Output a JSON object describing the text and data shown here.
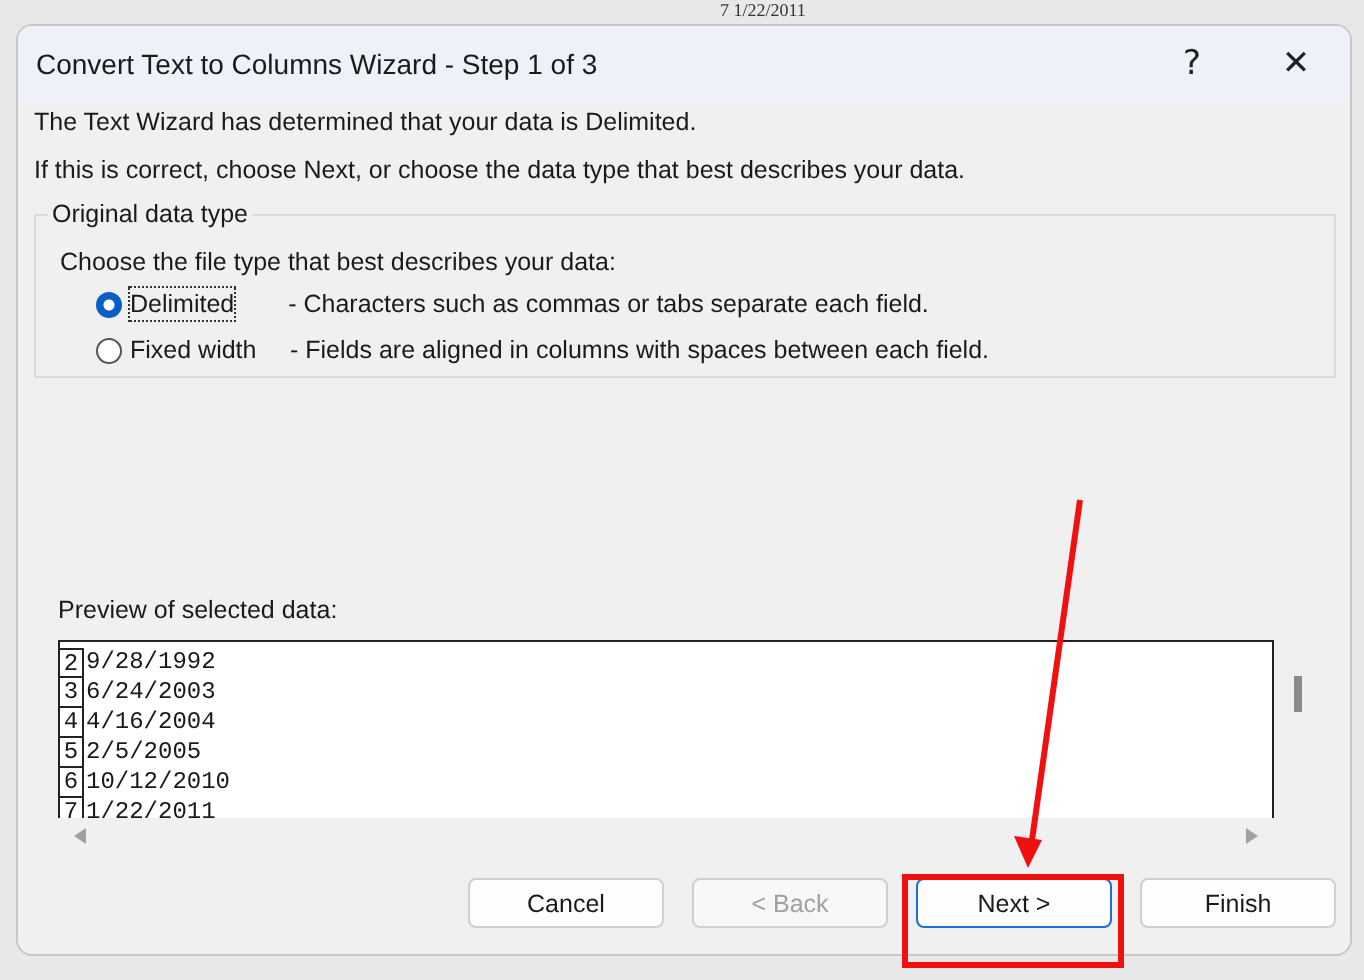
{
  "background": {
    "sheet_cell": "7 1/22/2011"
  },
  "window": {
    "title": "Convert Text to Columns Wizard - Step 1 of 3",
    "help": "?",
    "close": "✕"
  },
  "intro": [
    "The Text Wizard has determined that your data is Delimited.",
    "If this is correct, choose Next, or choose the data type that best describes your data."
  ],
  "data_type_group": {
    "legend": "Original data type",
    "prompt": "Choose the file type that best describes your data:",
    "options": [
      {
        "label": "Delimited",
        "description": "- Characters such as commas or tabs separate each field.",
        "selected": true
      },
      {
        "label": "Fixed width",
        "description": "- Fields are aligned in columns with spaces between each field.",
        "selected": false
      }
    ]
  },
  "preview": {
    "label": "Preview of selected data:",
    "rows": [
      {
        "number": "2",
        "text": "9/28/1992"
      },
      {
        "number": "3",
        "text": "6/24/2003"
      },
      {
        "number": "4",
        "text": "4/16/2004"
      },
      {
        "number": "5",
        "text": "2/5/2005"
      },
      {
        "number": "6",
        "text": "10/12/2010"
      },
      {
        "number": "7",
        "text": "1/22/2011"
      }
    ]
  },
  "buttons": [
    {
      "label": "Cancel",
      "disabled": false,
      "default": false
    },
    {
      "label": "< Back",
      "disabled": true,
      "default": false
    },
    {
      "label": "Next >",
      "disabled": false,
      "default": true
    },
    {
      "label": "Finish",
      "disabled": false,
      "default": false
    }
  ]
}
